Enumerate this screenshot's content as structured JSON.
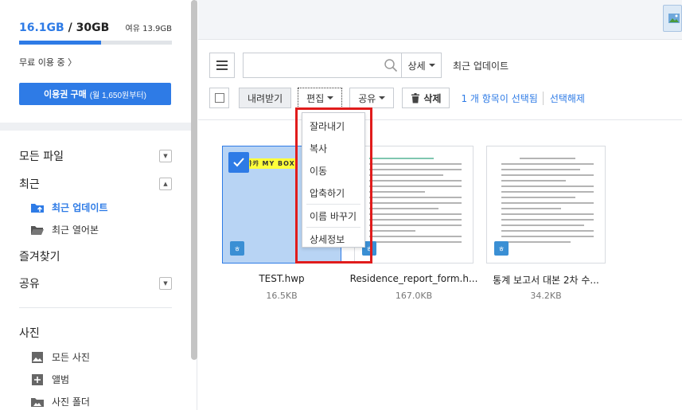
{
  "storage": {
    "used": "16.1GB",
    "sep": " / ",
    "total": "30GB",
    "free_text": "여유 13.9GB",
    "used_fraction": 0.537,
    "plan_text": "무료 이용 중 〉",
    "buy_label": "이용권 구매",
    "buy_sub": "(월 1,650원부터)"
  },
  "sidebar": {
    "all_files": "모든 파일",
    "recent": "최근",
    "recent_updated": "최근 업데이트",
    "recent_opened": "최근 열어본",
    "favorites": "즐겨찾기",
    "shared": "공유",
    "photos": "사진",
    "all_photos": "모든 사진",
    "album": "앨범",
    "photo_folder": "사진 폴더"
  },
  "toolbar": {
    "search_placeholder": "",
    "detail_label": "상세",
    "section_title": "최근 업데이트",
    "download": "내려받기",
    "edit": "편집",
    "share": "공유",
    "delete": "삭제",
    "selection_info": "1 개 항목이 선택됨",
    "clear_selection": "선택해제"
  },
  "dropdown": {
    "items": [
      "잘라내기",
      "복사",
      "이동",
      "압축하기",
      "이름 바꾸기",
      "상세정보"
    ]
  },
  "files": [
    {
      "name": "TEST.hwp",
      "size": "16.5KB",
      "badge": "ㅎ",
      "thumb_text": "캬캬 MY BOX"
    },
    {
      "name": "Residence_report_form.h...",
      "size": "167.0KB",
      "badge": "ㅎ"
    },
    {
      "name": "통계 보고서 대본 2차 수...",
      "size": "34.2KB",
      "badge": "ㅎ"
    }
  ],
  "colors": {
    "accent": "#2e7be6",
    "highlight": "#e01c1c"
  }
}
